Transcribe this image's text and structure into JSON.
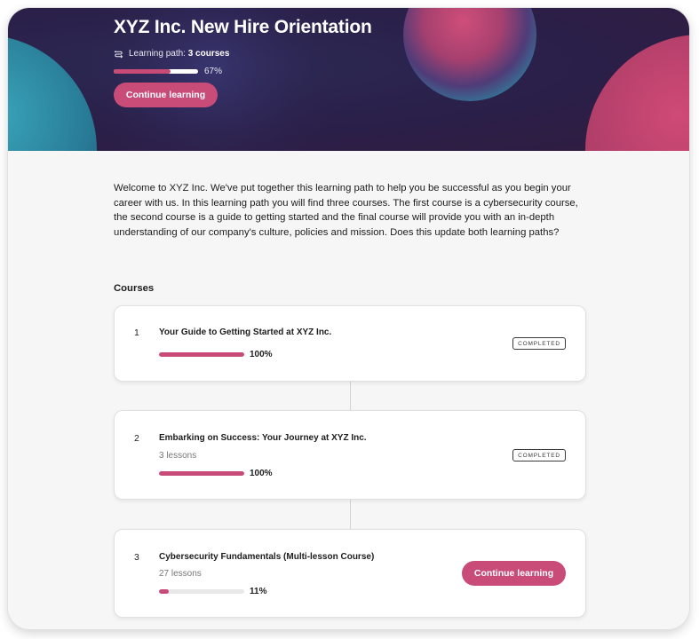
{
  "hero": {
    "title": "XYZ Inc. New Hire Orientation",
    "path_label": "Learning path: ",
    "path_count": "3 courses",
    "progress_pct": "67%",
    "progress_value": 0.67,
    "continue_label": "Continue learning"
  },
  "intro": "Welcome to XYZ Inc. We've put together this learning path to help you be successful as you begin your career with us. In this learning path you will find three courses. The first course is a cybersecurity course, the second course is a guide to getting started and the final course will provide you with an in-depth understanding of our company's culture, policies and mission. Does this update both learning paths?",
  "courses_heading": "Courses",
  "courses": [
    {
      "number": "1",
      "title": "Your Guide to Getting Started at XYZ Inc.",
      "lessons": "",
      "progress_pct": "100%",
      "progress_value": 1.0,
      "status": "COMPLETED"
    },
    {
      "number": "2",
      "title": "Embarking on Success: Your Journey at XYZ Inc.",
      "lessons": "3 lessons",
      "progress_pct": "100%",
      "progress_value": 1.0,
      "status": "COMPLETED"
    },
    {
      "number": "3",
      "title": "Cybersecurity Fundamentals (Multi-lesson Course)",
      "lessons": "27 lessons",
      "progress_pct": "11%",
      "progress_value": 0.11,
      "action_label": "Continue learning"
    }
  ],
  "colors": {
    "accent": "#c94c78",
    "hero_bg": "#2a1f48",
    "page_bg": "#f6f6f6",
    "teal": "#2a8ea5",
    "pink": "#c2426d"
  },
  "icons": {
    "learning_path": "path-route-icon"
  }
}
